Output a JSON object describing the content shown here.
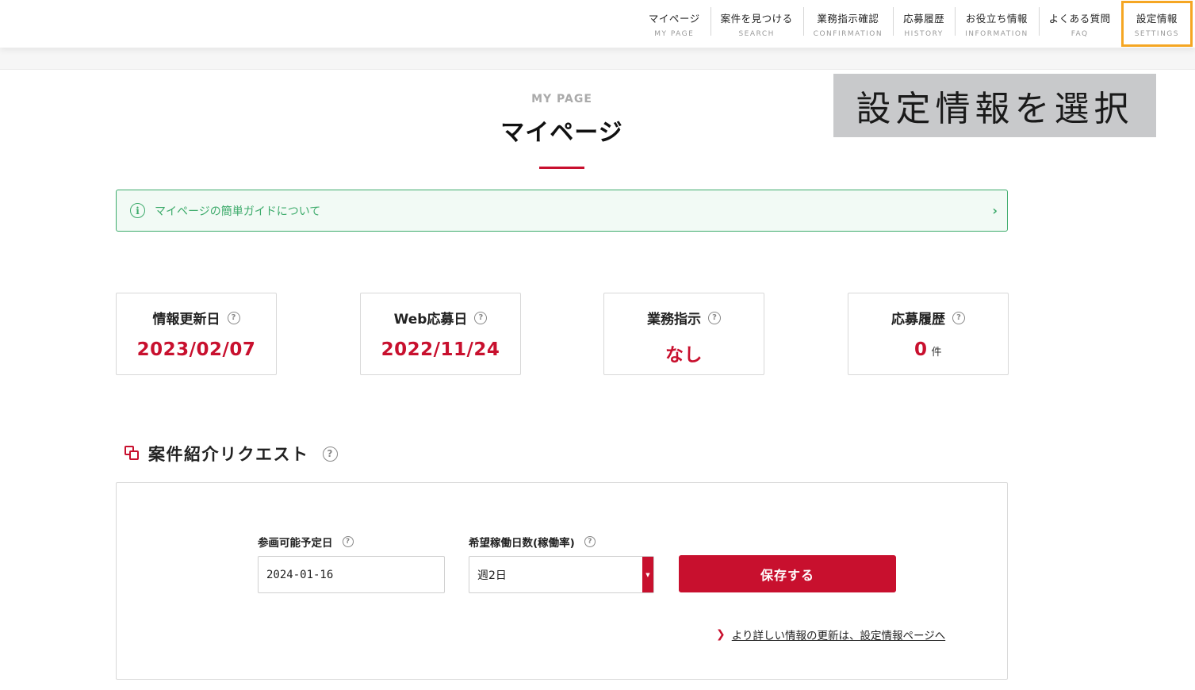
{
  "nav": [
    {
      "jp": "マイページ",
      "en": "MY PAGE"
    },
    {
      "jp": "案件を見つける",
      "en": "SEARCH"
    },
    {
      "jp": "業務指示確認",
      "en": "CONFIRMATION"
    },
    {
      "jp": "応募履歴",
      "en": "HISTORY"
    },
    {
      "jp": "お役立ち情報",
      "en": "INFORMATION"
    },
    {
      "jp": "よくある質問",
      "en": "FAQ"
    },
    {
      "jp": "設定情報",
      "en": "SETTINGS"
    }
  ],
  "annotation": "設定情報を選択",
  "page": {
    "en_title": "MY PAGE",
    "title": "マイページ"
  },
  "guide": {
    "text": "マイページの簡単ガイドについて",
    "info_icon": "i",
    "chevron": "›"
  },
  "cards": [
    {
      "label": "情報更新日",
      "value": "2023/02/07",
      "unit": ""
    },
    {
      "label": "Web応募日",
      "value": "2022/11/24",
      "unit": ""
    },
    {
      "label": "業務指示",
      "value": "なし",
      "unit": ""
    },
    {
      "label": "応募履歴",
      "value": "0",
      "unit": "件"
    }
  ],
  "help_glyph": "?",
  "request": {
    "title": "案件紹介リクエスト",
    "date_label": "参画可能予定日",
    "date_value": "2024-01-16",
    "days_label": "希望稼働日数(稼働率)",
    "days_value": "週2日",
    "save_label": "保存する",
    "link_text": "より詳しい情報の更新は、設定情報ページへ"
  },
  "colors": {
    "accent": "#c8102e",
    "guide_green": "#3dab6b",
    "highlight": "#f5a623"
  }
}
